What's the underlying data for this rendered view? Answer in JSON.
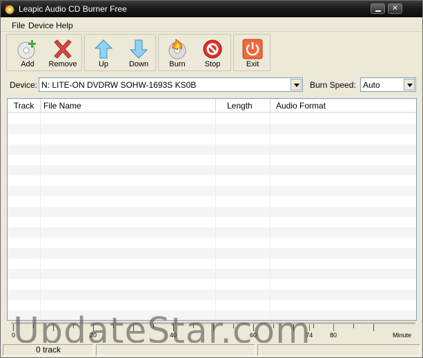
{
  "window": {
    "title": "Leapic Audio CD Burner Free"
  },
  "menu": [
    {
      "label": "File",
      "accel": "F"
    },
    {
      "label": "Device",
      "accel": "D"
    },
    {
      "label": "Help",
      "accel": "H"
    }
  ],
  "toolbar": {
    "add": "Add",
    "remove": "Remove",
    "up": "Up",
    "down": "Down",
    "burn": "Burn",
    "stop": "Stop",
    "exit": "Exit"
  },
  "device": {
    "label": "Device:",
    "value": "N: LITE-ON DVDRW SOHW-1693S KS0B",
    "speed_label": "Burn Speed:",
    "speed_value": "Auto"
  },
  "tracklist": {
    "columns": [
      "Track",
      "File Name",
      "Length",
      "Audio Format"
    ],
    "rows": []
  },
  "ruler": {
    "labels": [
      "0",
      "20",
      "40",
      "60",
      "74",
      "80"
    ],
    "unit": "Minute"
  },
  "watermark": "UpdateStar.com",
  "status": {
    "tracks": "0 track"
  },
  "colors": {
    "titlebar": "#1a1a1a",
    "up_arrow": "#6cc3ef",
    "remove_x": "#d94a3a",
    "stop": "#e0302a",
    "exit": "#f06a3a"
  }
}
